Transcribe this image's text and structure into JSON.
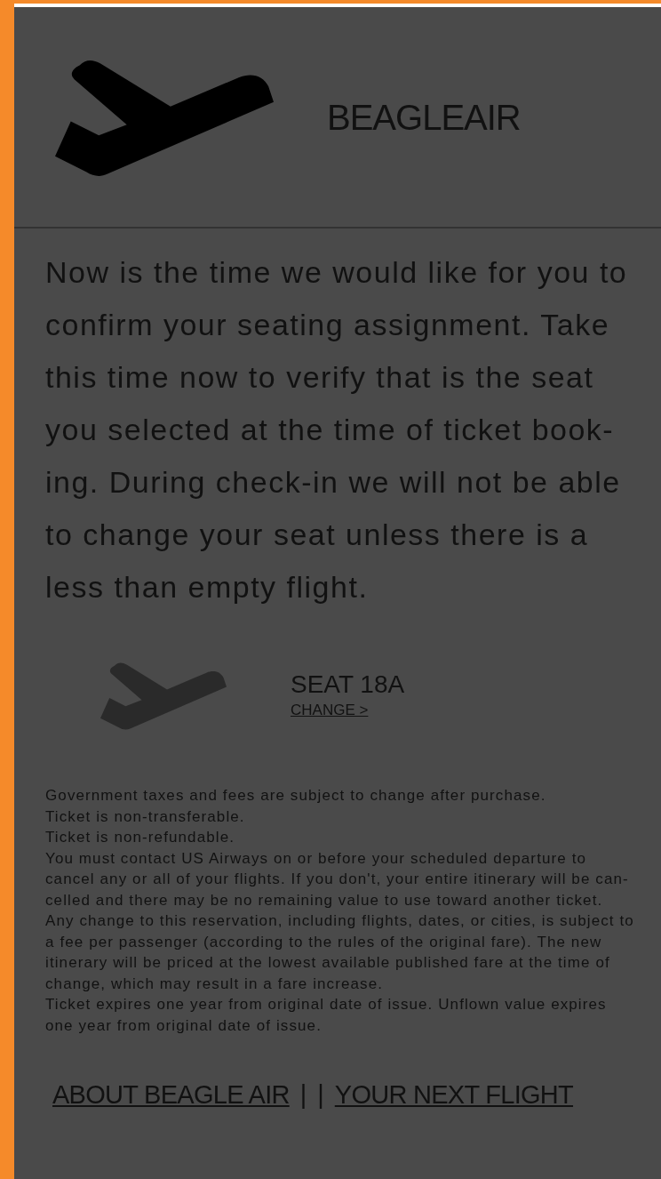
{
  "header": {
    "title": "BEAGLEAIR"
  },
  "intro": {
    "lines": [
      "Now is the time we would like for you to",
      "confirm your seating assignment. Take",
      "this time now to verify that is the seat",
      "you selected at the time of ticket book-",
      "ing. During check-in we will not be able",
      "to change your seat unless there is a",
      "less than empty flight."
    ]
  },
  "seat": {
    "label": "SEAT 18A",
    "link": "CHANGE >"
  },
  "fine_print": {
    "lines": [
      "Government taxes and fees are subject to change after purchase.",
      "Ticket is non-transferable.",
      "Ticket is non-refundable.",
      "You must contact US Airways on or before your scheduled departure to",
      "cancel any or all of your flights. If you don't, your entire itinerary will be can-",
      "celled and there may be no remaining value to use toward another ticket.",
      "Any change to this reservation, including flights, dates, or cities, is subject to",
      "a fee per passenger (according to the rules of the original fare). The new",
      "itinerary will be priced at the lowest available published fare at the time of",
      "change, which may result in a fare increase.",
      "Ticket expires one year from original date of issue. Unflown value expires",
      "one year from original date of issue."
    ]
  },
  "footer": {
    "links": [
      "ABOUT BEAGLE AIR",
      "YOUR NEXT FLIGHT"
    ],
    "separators": [
      "|",
      "|"
    ]
  }
}
